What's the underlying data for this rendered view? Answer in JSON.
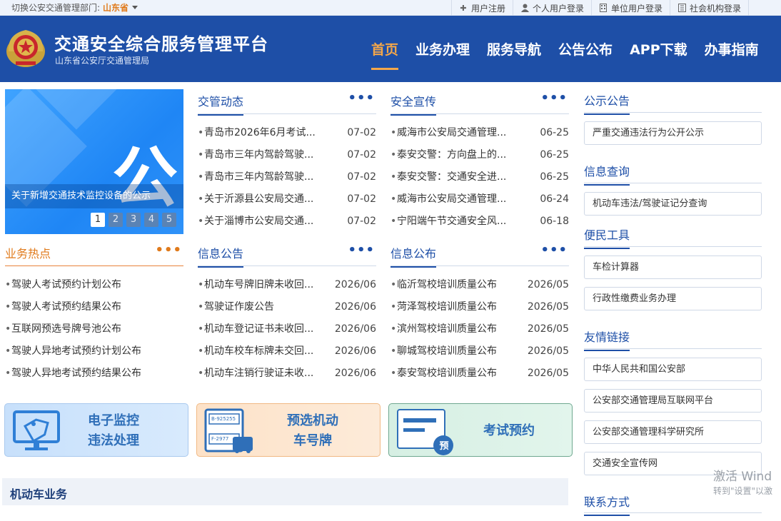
{
  "topbar": {
    "switch_label": "切换公安交通管理部门:",
    "province": "山东省",
    "links": [
      {
        "icon": "plus-icon",
        "label": "用户注册"
      },
      {
        "icon": "user-icon",
        "label": "个人用户登录"
      },
      {
        "icon": "building-icon",
        "label": "单位用户登录"
      },
      {
        "icon": "office-icon",
        "label": "社会机构登录"
      }
    ]
  },
  "header": {
    "title": "交通安全综合服务管理平台",
    "subtitle": "山东省公安厅交通管理局",
    "nav": [
      "首页",
      "业务办理",
      "服务导航",
      "公告公布",
      "APP下载",
      "办事指南"
    ],
    "active_nav": 0
  },
  "carousel": {
    "big_char": "公",
    "caption": "关于新增交通技术监控设备的公示",
    "pages": [
      "1",
      "2",
      "3",
      "4",
      "5"
    ],
    "active_page": 0
  },
  "panels": {
    "traffic_news": {
      "title": "交管动态",
      "more": "•••",
      "items": [
        {
          "title": "青岛市2026年6月考试...",
          "date": "07-02"
        },
        {
          "title": "青岛市三年内驾龄驾驶...",
          "date": "07-02"
        },
        {
          "title": "青岛市三年内驾龄驾驶...",
          "date": "07-02"
        },
        {
          "title": "关于沂源县公安局交通...",
          "date": "07-02"
        },
        {
          "title": "关于淄博市公安局交通...",
          "date": "07-02"
        }
      ]
    },
    "safety": {
      "title": "安全宣传",
      "more": "•••",
      "items": [
        {
          "title": "威海市公安局交通管理...",
          "date": "06-25"
        },
        {
          "title": "泰安交警：方向盘上的...",
          "date": "06-25"
        },
        {
          "title": "泰安交警：交通安全进...",
          "date": "06-25"
        },
        {
          "title": "威海市公安局交通管理...",
          "date": "06-24"
        },
        {
          "title": "宁阳端午节交通安全风...",
          "date": "06-18"
        }
      ]
    },
    "hot": {
      "title": "业务热点",
      "more": "•••",
      "items": [
        {
          "title": "驾驶人考试预约计划公布"
        },
        {
          "title": "驾驶人考试预约结果公布"
        },
        {
          "title": "互联网预选号牌号池公布"
        },
        {
          "title": "驾驶人异地考试预约计划公布"
        },
        {
          "title": "驾驶人异地考试预约结果公布"
        }
      ]
    },
    "notices": {
      "title": "信息公告",
      "more": "•••",
      "items": [
        {
          "title": "机动车号牌旧牌未收回...",
          "date": "2026/06"
        },
        {
          "title": "驾驶证作废公告",
          "date": "2026/06"
        },
        {
          "title": "机动车登记证书未收回...",
          "date": "2026/06"
        },
        {
          "title": "机动车校车标牌未交回...",
          "date": "2026/06"
        },
        {
          "title": "机动车注销行驶证未收...",
          "date": "2026/06"
        }
      ]
    },
    "info": {
      "title": "信息公布",
      "more": "•••",
      "items": [
        {
          "title": "临沂驾校培训质量公布",
          "date": "2026/05"
        },
        {
          "title": "菏泽驾校培训质量公布",
          "date": "2026/05"
        },
        {
          "title": "滨州驾校培训质量公布",
          "date": "2026/05"
        },
        {
          "title": "聊城驾校培训质量公布",
          "date": "2026/05"
        },
        {
          "title": "泰安驾校培训质量公布",
          "date": "2026/05"
        }
      ]
    }
  },
  "tiles": {
    "monitor": {
      "line1": "电子监控",
      "line2": "违法处理"
    },
    "plate": {
      "line1": "预选机动",
      "line2": "车号牌",
      "plate_a": "B-925255",
      "plate_b": "F-2977"
    },
    "exam": {
      "label": "考试预约",
      "badge": "预"
    }
  },
  "section": {
    "title": "机动车业务"
  },
  "right": {
    "public_title": "公示公告",
    "public_items": [
      "严重交通违法行为公开公示"
    ],
    "query_title": "信息查询",
    "query_items": [
      "机动车违法/驾驶证记分查询"
    ],
    "tools_title": "便民工具",
    "tools_items": [
      "车检计算器",
      "行政性缴费业务办理"
    ],
    "links_title": "友情链接",
    "links_items": [
      "中华人民共和国公安部",
      "公安部交通管理局互联网平台",
      "公安部交通管理科学研究所",
      "交通安全宣传网"
    ],
    "contact_title": "联系方式"
  },
  "watermark": {
    "line1": "激活 Wind",
    "line2": "转到\"设置\"以激"
  },
  "colors": {
    "brand": "#1e4fa7",
    "accent": "#f4a74a",
    "hot": "#e07a1b"
  }
}
